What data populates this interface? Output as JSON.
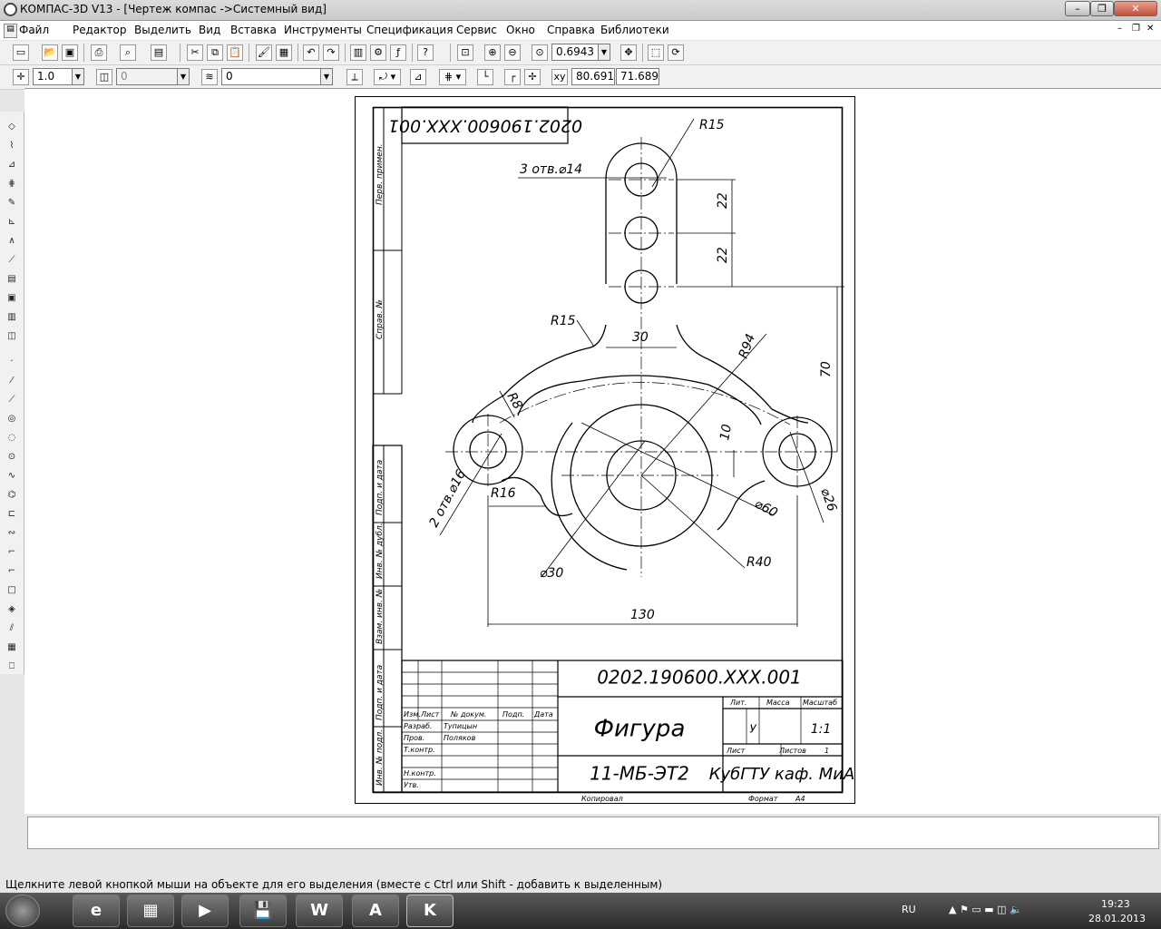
{
  "window": {
    "title": "КОМПАС-3D V13 - [Чертеж компас ->Системный вид]",
    "minimize": "–",
    "restore": "❐",
    "close": "✕",
    "doc_minimize": "–",
    "doc_restore": "❐",
    "doc_close": "✕"
  },
  "menu": [
    "Файл",
    "Редактор",
    "Выделить",
    "Вид",
    "Вставка",
    "Инструменты",
    "Спецификация",
    "Сервис",
    "Окно",
    "Справка",
    "Библиотеки"
  ],
  "toolbar1": {
    "zoom": "0.6943"
  },
  "toolbar2": {
    "step": "1.0",
    "layer_num": "0",
    "style": "0",
    "coord_x": "80.6916",
    "coord_y": "71.6897"
  },
  "drawing": {
    "doc_code_rotated": "0202.190600.XXX.001",
    "side_labels": [
      "Перв. примен.",
      "Справ. №",
      "Подп. и дата",
      "Инв. № дубл.",
      "Взам. инв. №",
      "Подп. и дата",
      "Инв. № подл."
    ],
    "dims": {
      "r15_top": "R15",
      "holes3": "3 отв.⌀14",
      "d22a": "22",
      "d22b": "22",
      "w30": "30",
      "r15_left": "R15",
      "r94": "R94",
      "h70": "70",
      "r8": "R8",
      "d10": "10",
      "holes2": "2 отв.⌀16",
      "r16": "R16",
      "d26": "⌀26",
      "d60": "⌀60",
      "d30": "⌀30",
      "r40": "R40",
      "w130": "130"
    },
    "title_block": {
      "code": "0202.190600.XXX.001",
      "name": "Фигура",
      "group": "11-МБ-ЭТ2",
      "org": "КубГТУ каф. МиА",
      "col_headers": [
        "Изм.",
        "Лист",
        "№ докум.",
        "Подп.",
        "Дата"
      ],
      "roles": [
        "Разраб.",
        "Пров.",
        "Т.контр.",
        "",
        "Н.контр.",
        "Утв."
      ],
      "people": [
        "Тупицын",
        "Поляков"
      ],
      "lit": "Лит.",
      "lit_value": "У",
      "mass": "Масса",
      "scale": "Масштаб",
      "scale_value": "1:1",
      "sheet": "Лист",
      "sheets": "Листов",
      "sheets_value": "1"
    },
    "copied": "Копировал",
    "format_label": "Формат",
    "format_value": "А4"
  },
  "status": "Щелкните левой кнопкой мыши на объекте для его выделения (вместе с Ctrl или Shift - добавить к выделенным)",
  "taskbar": {
    "apps": [
      "e",
      "▦",
      "▶",
      "💾",
      "W",
      "A",
      "K"
    ],
    "lang": "RU",
    "time": "19:23",
    "date": "28.01.2013"
  },
  "colors": {
    "titlebar": "#d0d0d0",
    "workspace": "#ffffff",
    "taskbar": "#3a3a3a"
  }
}
